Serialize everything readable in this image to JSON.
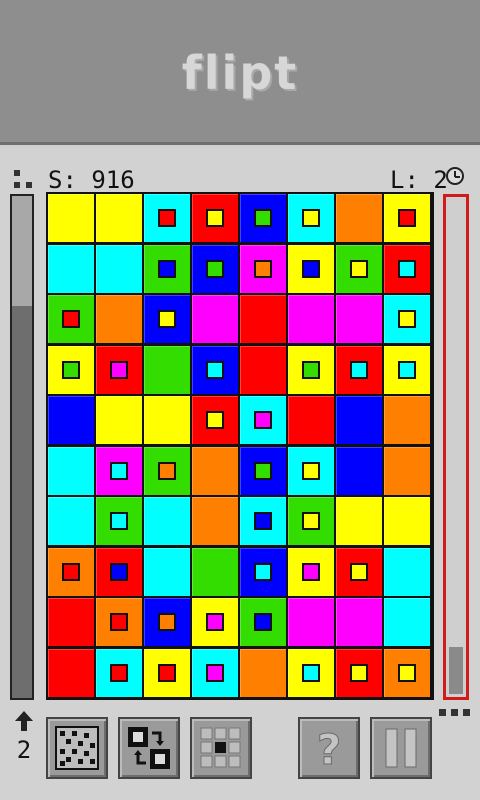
{
  "header": {
    "title": "flipt"
  },
  "status": {
    "score": "S: 916",
    "level": "L: 2",
    "level_up_count": "2"
  },
  "meters": {
    "left_fill_fraction": 0.78,
    "right_fill_fraction": 0.1
  },
  "board": {
    "rows": [
      [
        "Y|",
        "Y|",
        "C|R",
        "R|Y",
        "B|G",
        "C|Y",
        "O|",
        "Y|R"
      ],
      [
        "C|",
        "C|",
        "G|B",
        "B|G",
        "M|O",
        "Y|B",
        "G|Y",
        "R|C"
      ],
      [
        "G|R",
        "O|",
        "B|Y",
        "M|",
        "R|",
        "M|",
        "M|",
        "C|Y"
      ],
      [
        "Y|G",
        "R|M",
        "G|",
        "B|C",
        "R|",
        "Y|G",
        "R|C",
        "Y|C"
      ],
      [
        "B|",
        "Y|",
        "Y|",
        "R|Y",
        "C|M",
        "R|",
        "B|",
        "O|"
      ],
      [
        "C|",
        "M|C",
        "G|O",
        "O|",
        "B|G",
        "C|Y",
        "B|",
        "O|"
      ],
      [
        "C|",
        "G|C",
        "C|",
        "O|",
        "C|B",
        "G|Y",
        "Y|",
        "Y|"
      ],
      [
        "O|R",
        "R|B",
        "C|",
        "G|",
        "B|C",
        "Y|M",
        "R|Y",
        "C|"
      ],
      [
        "R|",
        "O|R",
        "B|O",
        "Y|M",
        "G|B",
        "M|",
        "M|",
        "C|"
      ],
      [
        "R|",
        "C|R",
        "Y|R",
        "C|M",
        "O|",
        "Y|C",
        "R|Y",
        "O|Y"
      ]
    ]
  },
  "palette": {
    "Y": "#ffff00",
    "C": "#00ffff",
    "R": "#ff0000",
    "B": "#0000ff",
    "G": "#33dd00",
    "M": "#ff00ff",
    "O": "#ff7f00"
  },
  "toolbar": {
    "buttons": [
      {
        "name": "scramble-button",
        "icon": "dotted-grid-icon"
      },
      {
        "name": "swap-button",
        "icon": "swap-arrows-icon"
      },
      {
        "name": "center-button",
        "icon": "grid-center-icon"
      },
      {
        "name": "help-button",
        "icon": "question-mark-icon",
        "label": "?"
      },
      {
        "name": "pause-button",
        "icon": "pause-icon"
      }
    ]
  }
}
